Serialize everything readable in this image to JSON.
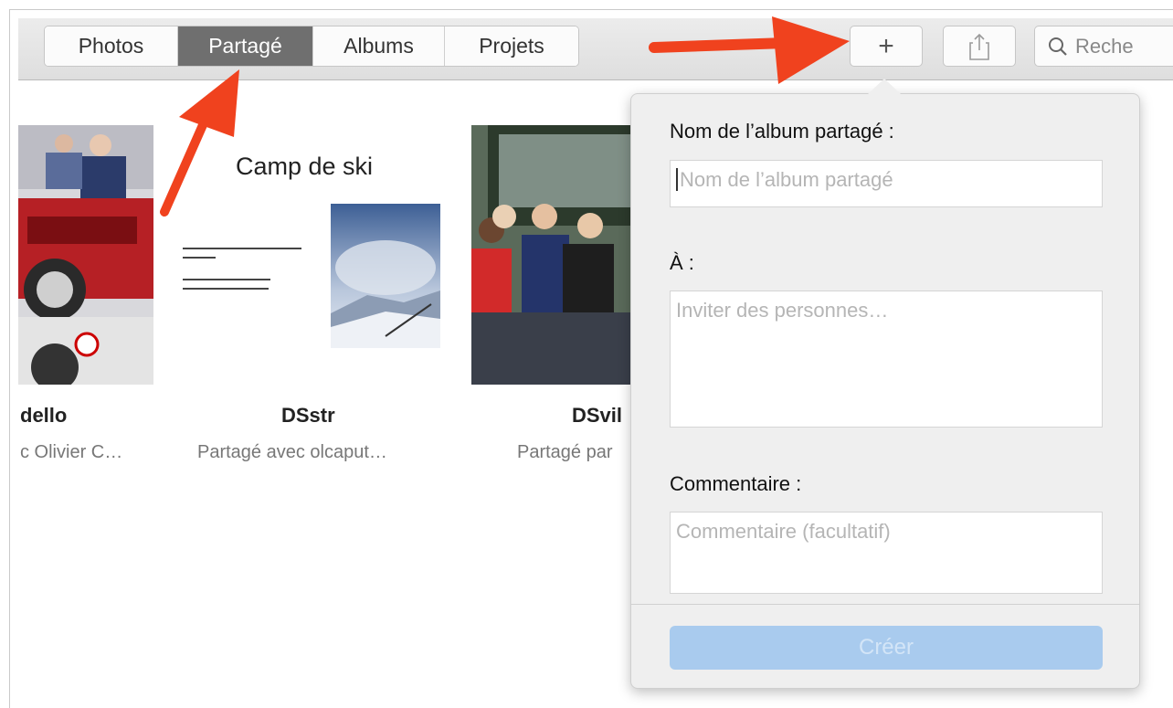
{
  "toolbar": {
    "tabs": [
      {
        "label": "Photos",
        "active": false
      },
      {
        "label": "Partagé",
        "active": true
      },
      {
        "label": "Albums",
        "active": false
      },
      {
        "label": "Projets",
        "active": false
      }
    ],
    "add_label": "+",
    "share_icon": "share-icon",
    "search_placeholder": "Reche"
  },
  "albums": [
    {
      "name": "dello",
      "subtitle": "c Olivier C…"
    },
    {
      "name": "DSstr",
      "subtitle": "Partagé avec olcaput…",
      "cover_title": "Camp de ski"
    },
    {
      "name": "DSvil",
      "subtitle": "Partagé par"
    }
  ],
  "popover": {
    "album_name_label": "Nom de l’album partagé :",
    "album_name_placeholder": "Nom de l’album partagé",
    "to_label": "À :",
    "to_placeholder": "Inviter des personnes…",
    "comment_label": "Commentaire :",
    "comment_placeholder": "Commentaire (facultatif)",
    "create_label": "Créer"
  },
  "colors": {
    "annotation_arrow": "#f0421e",
    "create_button": "#a9cbee",
    "active_tab": "#6f6f6f"
  }
}
